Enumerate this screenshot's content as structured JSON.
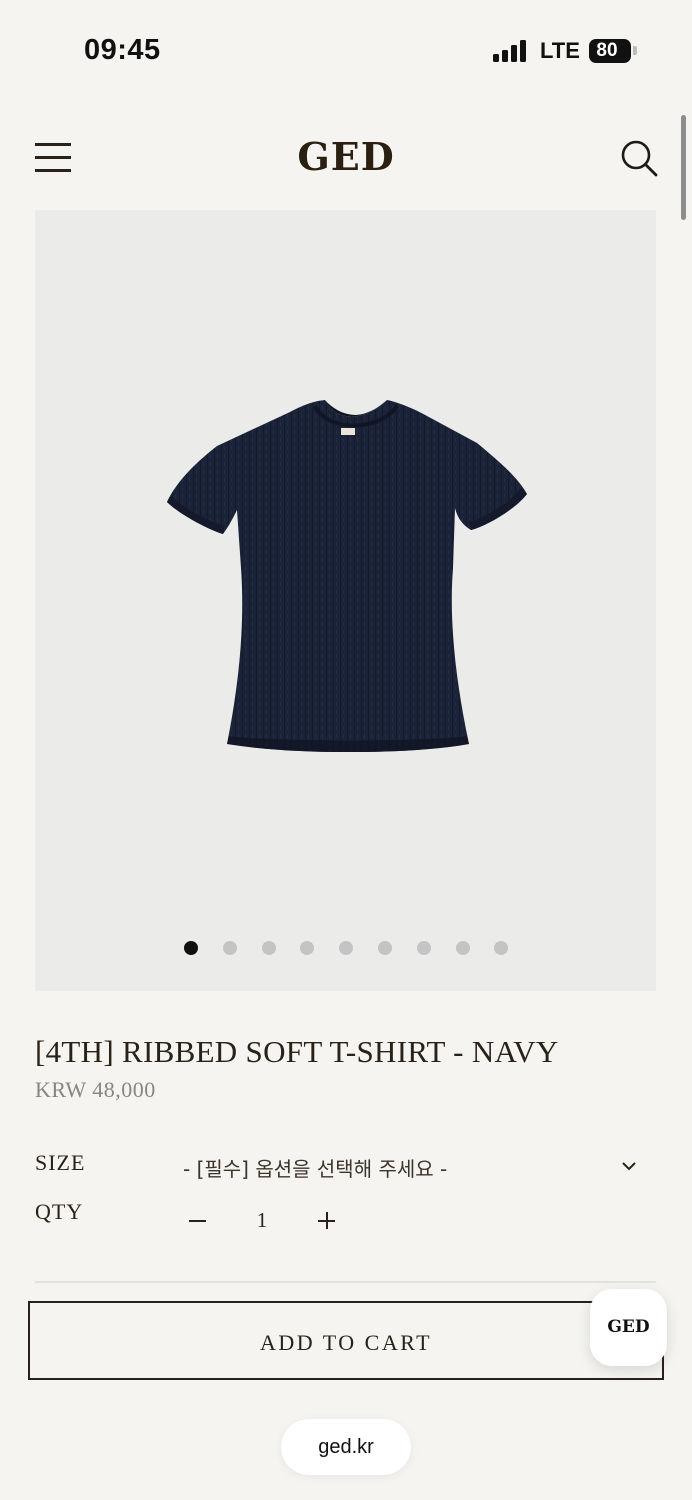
{
  "status_bar": {
    "time": "09:45",
    "network": "LTE",
    "battery": "80"
  },
  "header": {
    "brand": "GED",
    "menu_icon": "hamburger-menu-icon",
    "search_icon": "search-icon"
  },
  "gallery": {
    "image_subject": "navy short-sleeve ribbed t-shirt",
    "dot_count": 9,
    "active_index": 0
  },
  "product": {
    "title": "[4TH] RIBBED SOFT T-SHIRT - NAVY",
    "price": "KRW 48,000"
  },
  "options": {
    "size_label": "SIZE",
    "size_value": "- [필수] 옵션을 선택해 주세요 -",
    "qty_label": "QTY",
    "qty_value": "1"
  },
  "cta": {
    "add_to_cart": "ADD TO CART"
  },
  "floating": {
    "ged_button": "GED"
  },
  "browser": {
    "url": "ged.kr"
  },
  "colors": {
    "background": "#f5f4f1",
    "text": "#2a2218",
    "price": "#8a857e",
    "shirt": "#1b2338",
    "dot_active": "#111111",
    "dot_inactive": "#c4c4c4"
  }
}
